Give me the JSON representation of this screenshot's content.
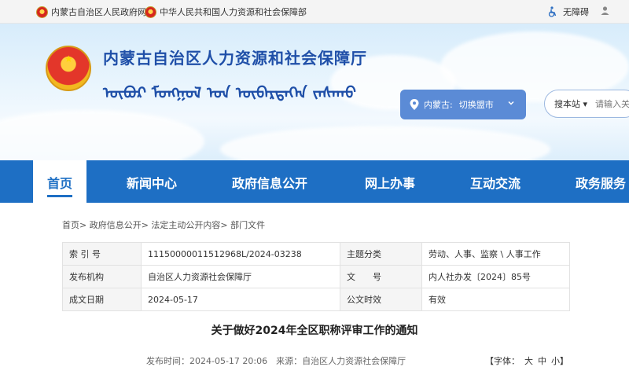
{
  "topbar": {
    "link1": "内蒙古自治区人民政府网站",
    "link2": "中华人民共和国人力资源和社会保障部",
    "accessibility": "无障碍",
    "user_icon": "user-icon"
  },
  "header": {
    "title": "内蒙古自治区人力资源和社会保障厅",
    "mongolian_title": "ᠥᠪᠥᠷ ᠮᠣᠩᠭᠣᠯ ᠤᠨ ᠥᠪᠡᠷᠲᠡᠭᠡᠨ ᠵᠠᠰᠠᠬᠤ",
    "region_label": "内蒙古:",
    "region_switch": "切换盟市",
    "search_scope": "搜本站",
    "search_placeholder": "请输入关键词"
  },
  "nav": {
    "items": [
      "首页",
      "新闻中心",
      "政府信息公开",
      "网上办事",
      "互动交流",
      "政务服务"
    ],
    "active": 0
  },
  "breadcrumb": {
    "text": "首页> 政府信息公开> 法定主动公开内容> 部门文件"
  },
  "info": {
    "index_label": "索 引 号",
    "index_value": "11150000011512968L/2024-03238",
    "topic_label": "主题分类",
    "topic_value": "劳动、人事、监察 \\ 人事工作",
    "issuer_label": "发布机构",
    "issuer_value": "自治区人力资源社会保障厅",
    "docno_label": "文　　号",
    "docno_value": "内人社办发〔2024〕85号",
    "date_label": "成文日期",
    "date_value": "2024-05-17",
    "validity_label": "公文时效",
    "validity_value": "有效"
  },
  "article": {
    "title": "关于做好2024年全区职称评审工作的通知",
    "meta": "发布时间：2024-05-17 20:06　来源：自治区人力资源社会保障厅",
    "font_label": "【字体：",
    "font_large": "大",
    "font_medium": "中",
    "font_small": "小】"
  },
  "colors": {
    "nav_blue": "#1e6fc4",
    "title_blue": "#1f4fa8"
  }
}
